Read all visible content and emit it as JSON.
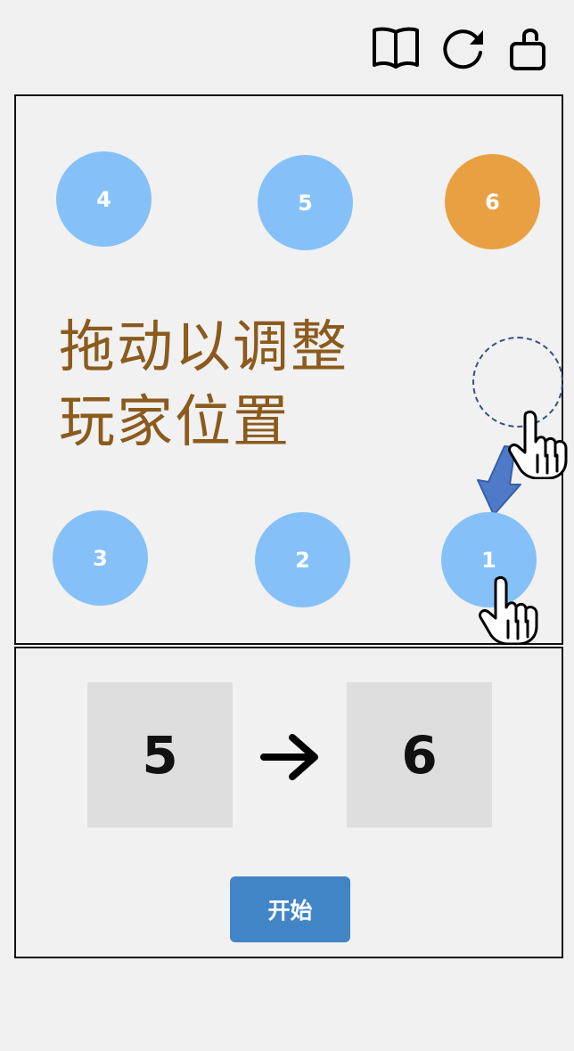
{
  "toolbar": {
    "icons": [
      "book-icon",
      "refresh-icon",
      "unlock-icon"
    ]
  },
  "board": {
    "hint_line1": "拖动以调整",
    "hint_line2": "玩家位置",
    "players": [
      {
        "number": "4",
        "state": "normal"
      },
      {
        "number": "5",
        "state": "normal"
      },
      {
        "number": "6",
        "state": "active"
      },
      {
        "number": "3",
        "state": "normal"
      },
      {
        "number": "2",
        "state": "normal"
      },
      {
        "number": "1",
        "state": "normal"
      }
    ]
  },
  "turn": {
    "from": "5",
    "to": "6"
  },
  "actions": {
    "start_label": "开始"
  },
  "colors": {
    "player": "#85C1F8",
    "active_player": "#E9A043",
    "hint_text": "#8B5A1D",
    "button": "#4285C7",
    "number_box": "#DEDEDE"
  }
}
